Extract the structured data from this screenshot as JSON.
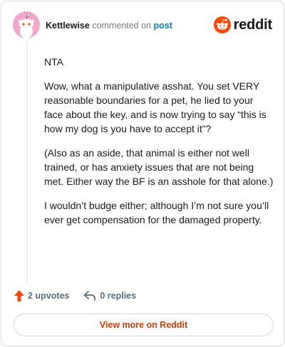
{
  "header": {
    "username": "Kettlewise",
    "verb": "commented on",
    "post_link": "post",
    "logo_text": "reddit"
  },
  "comment": {
    "paragraphs": [
      "NTA",
      "Wow, what a manipulative asshat. You set VERY reasonable boundaries for a pet, he lied to your face about the key, and is now trying to say “this is how my dog is you have to accept it”?",
      "(Also as an aside, that animal is either not well trained, or has anxiety issues that are not being met. Either way the BF is an asshole for that alone.)",
      "I wouldn’t budge either; although I’m not sure you’ll ever get compensation for the damaged property."
    ]
  },
  "footer": {
    "upvotes": "2 upvotes",
    "replies": "0 replies",
    "view_more": "View more on Reddit"
  },
  "colors": {
    "brand": "#ff4500",
    "link": "#0079d3",
    "cta": "#d93a00"
  },
  "icons": {
    "avatar": "snoo-avatar",
    "logo": "reddit-logo-icon",
    "upvote": "upvote-arrow-icon",
    "reply": "reply-arrow-icon"
  }
}
